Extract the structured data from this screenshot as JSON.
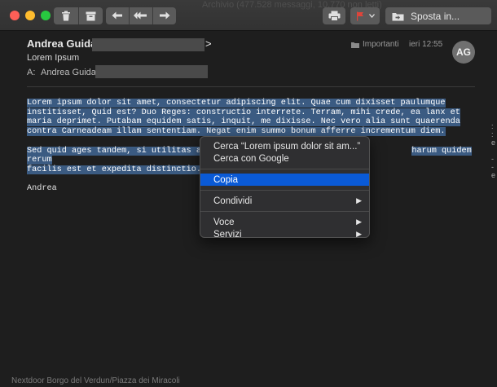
{
  "window": {
    "title_partial": "Archivio (477.528 messaggi, 10.770 non letti)"
  },
  "toolbar": {
    "trash_icon": "trash-icon",
    "archive_icon": "archive-icon",
    "reply_icon": "reply-icon",
    "reply_all_icon": "reply-all-icon",
    "forward_icon": "forward-icon",
    "print_icon": "printer-icon",
    "flag_color": "#e0443a",
    "move_label": "Sposta in..."
  },
  "message": {
    "from_name": "Andrea Guida <",
    "from_close": ">",
    "subject": "Lorem Ipsum",
    "to_label": "A:",
    "to_name": "Andrea Guida",
    "folder": "Importanti",
    "date": "ieri 12:55",
    "avatar_initials": "AG"
  },
  "body": {
    "p1": "Lorem ipsum dolor sit amet, consectetur adipiscing elit. Quae cum dixisset paulumque institisset, Quid est? Duo Reges: constructio interrete. Terram, mihi crede, ea lanx et maria deprimet. Putabam equidem satis, inquit, me dixisse. Nec vero alia sunt quaerenda contra Carneadeam illam sententiam. Negat enim summo bonum afferre incrementum diem.",
    "p2_start": "Sed quid ages tandem, si utilitas ab a",
    "p2_end": "harum quidem rerum",
    "p2_line2": "facilis est et expedita distinctio.",
    "signature": "Andrea"
  },
  "context_menu": {
    "search_selection": "Cerca “Lorem ipsum dolor sit am...”",
    "search_google": "Cerca con Google",
    "copy": "Copia",
    "share": "Condividi",
    "voice": "Voce",
    "services": "Servizi"
  },
  "background": {
    "footer_text": "Nextdoor Borgo del Verdun/Piazza dei Miracoli"
  }
}
